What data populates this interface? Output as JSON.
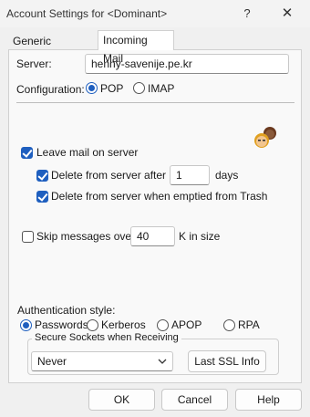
{
  "window": {
    "title": "Account Settings for <Dominant>",
    "help_glyph": "?",
    "close_glyph": "✕"
  },
  "tabs": [
    {
      "label": "Generic Properties",
      "active": false
    },
    {
      "label": "Incoming Mail",
      "active": true
    }
  ],
  "server": {
    "label": "Server:",
    "value": "henny-savenije.pe.kr"
  },
  "configuration": {
    "label": "Configuration:",
    "options": [
      {
        "label": "POP",
        "selected": true
      },
      {
        "label": "IMAP",
        "selected": false
      }
    ]
  },
  "leave_mail": {
    "label": "Leave mail on server",
    "checked": true
  },
  "delete_after": {
    "label": "Delete from server after",
    "value": "1",
    "unit": "days",
    "checked": true
  },
  "delete_trash": {
    "label": "Delete from server when emptied from Trash",
    "checked": true
  },
  "skip_messages": {
    "label": "Skip messages over",
    "value": "40",
    "unit": "K in size",
    "checked": false
  },
  "auth": {
    "label": "Authentication style:",
    "options": [
      {
        "label": "Passwords",
        "selected": true
      },
      {
        "label": "Kerberos",
        "selected": false
      },
      {
        "label": "APOP",
        "selected": false
      },
      {
        "label": "RPA",
        "selected": false
      }
    ]
  },
  "ssl": {
    "group_label": "Secure Sockets when Receiving",
    "selected": "Never",
    "info_button": "Last SSL Info"
  },
  "footer": {
    "ok": "OK",
    "cancel": "Cancel",
    "help": "Help"
  },
  "icons": {
    "persona": "people-avatars-icon",
    "dropdown": "chevron-down-icon"
  },
  "colors": {
    "accent": "#1f5fbf"
  }
}
